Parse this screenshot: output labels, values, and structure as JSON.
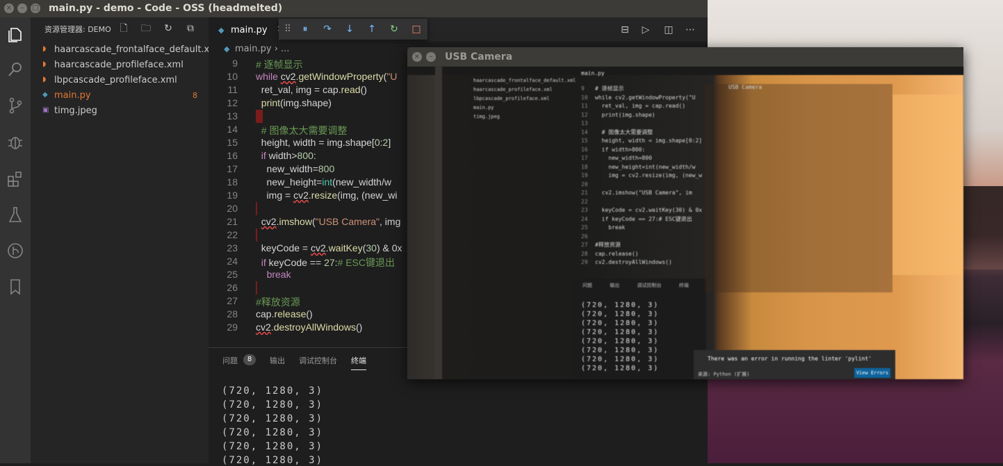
{
  "window": {
    "title": "main.py - demo - Code - OSS (headmelted)"
  },
  "activity_bar": {
    "icons": [
      "files-icon",
      "search-icon",
      "source-control-icon",
      "debug-icon",
      "extensions-icon",
      "testing-flask-icon",
      "git-graph-icon",
      "bookmark-icon"
    ]
  },
  "sidebar": {
    "header": "资源管理器: DEMO",
    "files": [
      {
        "name": "haarcascade_frontalface_default.xml",
        "icon": "rss-xml-icon",
        "badge": ""
      },
      {
        "name": "haarcascade_profileface.xml",
        "icon": "rss-xml-icon",
        "badge": ""
      },
      {
        "name": "lbpcascade_profileface.xml",
        "icon": "rss-xml-icon",
        "badge": ""
      },
      {
        "name": "main.py",
        "icon": "python-icon",
        "badge": "8"
      },
      {
        "name": "timg.jpeg",
        "icon": "image-icon",
        "badge": ""
      }
    ]
  },
  "editor": {
    "tab": "main.py",
    "breadcrumb": "main.py › ...",
    "lines": [
      {
        "n": "9",
        "parts": [
          [
            "cm",
            "# 逐帧显示"
          ]
        ]
      },
      {
        "n": "10",
        "parts": [
          [
            "kw",
            "while "
          ],
          [
            "squig",
            "cv2"
          ],
          [
            "",
            "."
          ],
          [
            "fn",
            "getWindowProperty"
          ],
          [
            "",
            "("
          ],
          [
            "st",
            "\"U"
          ]
        ]
      },
      {
        "n": "11",
        "parts": [
          [
            "",
            "  ret_val, img = cap."
          ],
          [
            "fn",
            "read"
          ],
          [
            "",
            "()"
          ]
        ]
      },
      {
        "n": "12",
        "parts": [
          [
            "",
            "  "
          ],
          [
            "fn",
            "print"
          ],
          [
            "",
            "(img.shape)"
          ]
        ]
      },
      {
        "n": "13",
        "parts": [],
        "gutter": "block"
      },
      {
        "n": "14",
        "parts": [
          [
            "",
            "  "
          ],
          [
            "cm",
            "# 图像太大需要调整"
          ]
        ]
      },
      {
        "n": "15",
        "parts": [
          [
            "",
            "  height, width = img.shape["
          ],
          [
            "nm",
            "0"
          ],
          [
            "",
            ":"
          ],
          [
            "nm",
            "2"
          ],
          [
            "",
            "]"
          ]
        ]
      },
      {
        "n": "16",
        "parts": [
          [
            "",
            "  "
          ],
          [
            "kw",
            "if "
          ],
          [
            "",
            "width>"
          ],
          [
            "nm",
            "800"
          ],
          [
            "",
            ":"
          ]
        ]
      },
      {
        "n": "17",
        "parts": [
          [
            "",
            "    new_width="
          ],
          [
            "nm",
            "800"
          ]
        ]
      },
      {
        "n": "18",
        "parts": [
          [
            "",
            "    new_height="
          ],
          [
            "bi",
            "int"
          ],
          [
            "",
            "(new_width/w"
          ]
        ]
      },
      {
        "n": "19",
        "parts": [
          [
            "",
            "    img = "
          ],
          [
            "squig",
            "cv2"
          ],
          [
            "",
            "."
          ],
          [
            "fn",
            "resize"
          ],
          [
            "",
            "(img, (new_wi"
          ]
        ]
      },
      {
        "n": "20",
        "parts": [],
        "gutter": "line"
      },
      {
        "n": "21",
        "parts": [
          [
            "",
            "  "
          ],
          [
            "squig",
            "cv2"
          ],
          [
            "",
            "."
          ],
          [
            "fn",
            "imshow"
          ],
          [
            "",
            "("
          ],
          [
            "st",
            "\"USB Camera\""
          ],
          [
            "",
            ", img"
          ]
        ]
      },
      {
        "n": "22",
        "parts": [],
        "gutter": "line"
      },
      {
        "n": "23",
        "parts": [
          [
            "",
            "  keyCode = "
          ],
          [
            "squig",
            "cv2"
          ],
          [
            "",
            "."
          ],
          [
            "fn",
            "waitKey"
          ],
          [
            "",
            "("
          ],
          [
            "nm",
            "30"
          ],
          [
            "",
            ") & 0x"
          ]
        ]
      },
      {
        "n": "24",
        "parts": [
          [
            "",
            "  "
          ],
          [
            "kw",
            "if "
          ],
          [
            "",
            "keyCode == "
          ],
          [
            "nm",
            "27"
          ],
          [
            "",
            ":"
          ],
          [
            "cm",
            "# ESC键退出"
          ]
        ]
      },
      {
        "n": "25",
        "parts": [
          [
            "",
            "    "
          ],
          [
            "kw",
            "break"
          ]
        ]
      },
      {
        "n": "26",
        "parts": [],
        "gutter": "line"
      },
      {
        "n": "27",
        "parts": [
          [
            "cm",
            "#释放资源"
          ]
        ]
      },
      {
        "n": "28",
        "parts": [
          [
            "",
            "cap."
          ],
          [
            "fn",
            "release"
          ],
          [
            "",
            "()"
          ]
        ]
      },
      {
        "n": "29",
        "parts": [
          [
            "squig",
            "cv2"
          ],
          [
            "",
            "."
          ],
          [
            "fn",
            "destroyAllWindows"
          ],
          [
            "",
            "()"
          ]
        ]
      }
    ]
  },
  "panel": {
    "tabs": [
      "问题",
      "输出",
      "调试控制台",
      "终端"
    ],
    "problems_count": "8",
    "active_tab": "终端",
    "terminal_lines": [
      "(720, 1280, 3)",
      "(720, 1280, 3)",
      "(720, 1280, 3)",
      "(720, 1280, 3)",
      "(720, 1280, 3)",
      "(720, 1280, 3)"
    ]
  },
  "camera_window": {
    "title": "USB Camera",
    "inner_text": {
      "tab": "main.py",
      "files": [
        "haarcascade_frontalface_default.xml",
        "haarcascade_profileface.xml",
        "lbpcascade_profileface.xml",
        "main.py",
        "timg.jpeg"
      ],
      "code": [
        "# 逐帧显示",
        "while cv2.getWindowProperty(\"U",
        "  ret_val, img = cap.read()",
        "  print(img.shape)",
        "",
        "  # 图像太大需要调整",
        "  height, width = img.shape[0:2]",
        "  if width>800:",
        "    new_width=800",
        "    new_height=int(new_width/w",
        "    img = cv2.resize(img, (new_w",
        "",
        "  cv2.imshow(\"USB Camera\", im",
        "",
        "  keyCode = cv2.waitKey(30) & 0x",
        "  if keyCode == 27:# ESC键退出",
        "    break",
        "",
        "#释放资源",
        "cap.release()",
        "cv2.destroyAllWindows()"
      ],
      "line_numbers": [
        "9",
        "10",
        "11",
        "12",
        "13",
        "14",
        "15",
        "16",
        "17",
        "18",
        "19",
        "20",
        "21",
        "22",
        "23",
        "24",
        "25",
        "26",
        "27",
        "28",
        "29"
      ],
      "panel_tabs": [
        "问题",
        "输出",
        "调试控制台",
        "终端"
      ],
      "terminal": [
        "(720, 1280, 3)",
        "(720, 1280, 3)",
        "(720, 1280, 3)",
        "(720, 1280, 3)",
        "(720, 1280, 3)",
        "(720, 1280, 3)",
        "(720, 1280, 3)",
        "(720, 1280, 3)"
      ],
      "inner_window_title": "USB Camera",
      "notification": "There was an error in running the linter 'pylint'",
      "notification_source": "来源: Python (扩展)",
      "view_errors": "View Errors"
    }
  }
}
